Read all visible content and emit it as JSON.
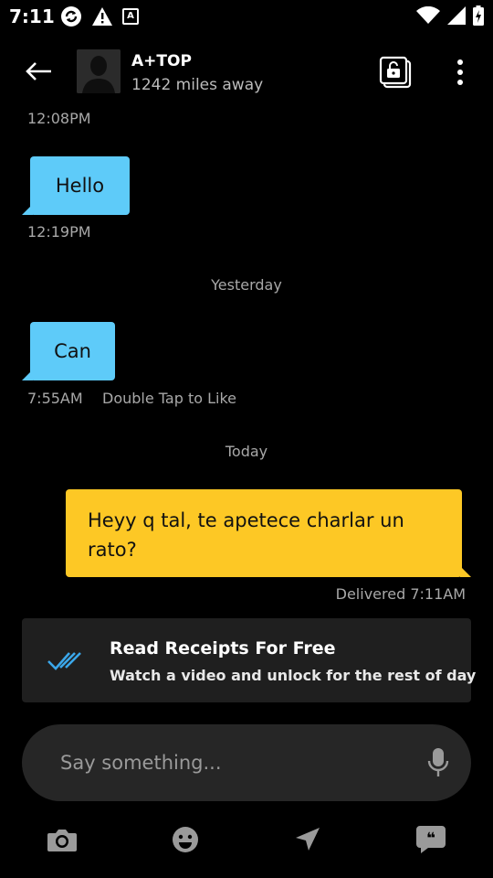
{
  "status_bar": {
    "time": "7:11",
    "keyboard_badge": "A"
  },
  "header": {
    "name": "A+TOP",
    "distance": "1242 miles away"
  },
  "messages": {
    "m0_time": "12:08PM",
    "m1_text": "Hello",
    "m1_time": "12:19PM",
    "divider_yesterday": "Yesterday",
    "m2_text": "Can",
    "m2_time": "7:55AM",
    "m2_hint": "Double Tap to Like",
    "divider_today": "Today",
    "m3_text": "Heyy q tal, te apetece charlar un rato?",
    "m3_status": "Delivered 7:11AM"
  },
  "promo": {
    "title": "Read Receipts For Free",
    "subtitle": "Watch a video and unlock for the rest of day"
  },
  "composer": {
    "placeholder": "Say something..."
  },
  "colors": {
    "incoming_bubble": "#5ecbf9",
    "outgoing_bubble": "#fdc825",
    "receipt_check": "#3ba7ea"
  },
  "toolbar_icons": [
    "camera-icon",
    "emoji-icon",
    "location-icon",
    "quick-reply-icon"
  ]
}
